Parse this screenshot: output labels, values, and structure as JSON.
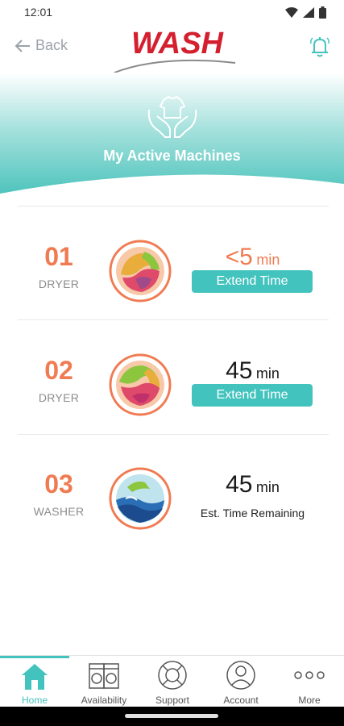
{
  "status": {
    "time": "12:01"
  },
  "header": {
    "back_label": "Back",
    "logo_text": "WASH"
  },
  "hero": {
    "title": "My Active Machines"
  },
  "machines": [
    {
      "number": "01",
      "type": "DRYER",
      "time_value": "<5",
      "time_unit": "min",
      "action_label": "Extend Time",
      "time_color": "#f07b52"
    },
    {
      "number": "02",
      "type": "DRYER",
      "time_value": "45",
      "time_unit": "min",
      "action_label": "Extend Time",
      "time_color": "#1a1a1a"
    },
    {
      "number": "03",
      "type": "WASHER",
      "time_value": "45",
      "time_unit": "min",
      "caption": "Est. Time Remaining",
      "time_color": "#1a1a1a"
    }
  ],
  "tabs": [
    {
      "label": "Home",
      "icon": "home-icon",
      "active": true
    },
    {
      "label": "Availability",
      "icon": "washer-dryer-icon"
    },
    {
      "label": "Support",
      "icon": "lifebuoy-icon"
    },
    {
      "label": "Account",
      "icon": "user-icon"
    },
    {
      "label": "More",
      "icon": "more-dots-icon"
    }
  ],
  "colors": {
    "accent": "#43c3be",
    "orange": "#f07b52",
    "brand_red": "#d41f2f"
  }
}
